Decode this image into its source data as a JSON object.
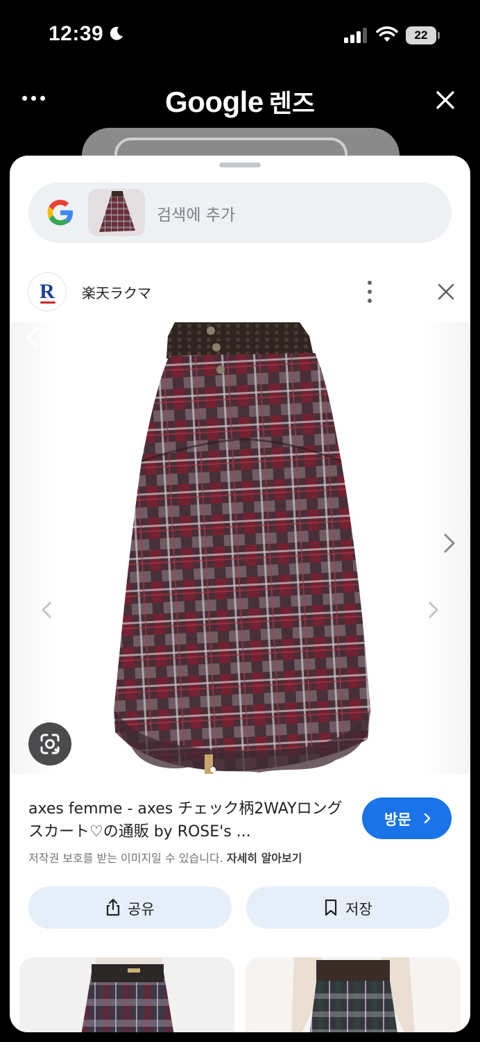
{
  "status_bar": {
    "time": "12:39",
    "battery": "22"
  },
  "header": {
    "title_google": "Google",
    "title_lens": "렌즈"
  },
  "search": {
    "placeholder": "검색에 추가"
  },
  "source": {
    "logo_letter": "R",
    "name": "楽天ラクマ"
  },
  "result": {
    "title": "axes femme - axes チェック柄2WAYロングスカート♡の通販 by ROSE's ...",
    "visit_label": "방문",
    "copyright_notice": "저작권 보호를 받는 이미지일 수 있습니다.",
    "learn_more": "자세히 알아보기"
  },
  "actions": {
    "share_label": "공유",
    "save_label": "저장"
  },
  "colors": {
    "accent": "#1a73e8",
    "action_bg": "#e6eef9",
    "skirt_base": "#4a2a33",
    "skirt_red": "#7a1f2e"
  },
  "icons": [
    "moon-icon",
    "signal-icon",
    "wifi-icon",
    "more-icon",
    "close-icon",
    "google-g-icon",
    "kebab-icon",
    "chevron-left-icon",
    "chevron-right-icon",
    "lens-icon",
    "share-icon",
    "bookmark-icon"
  ]
}
